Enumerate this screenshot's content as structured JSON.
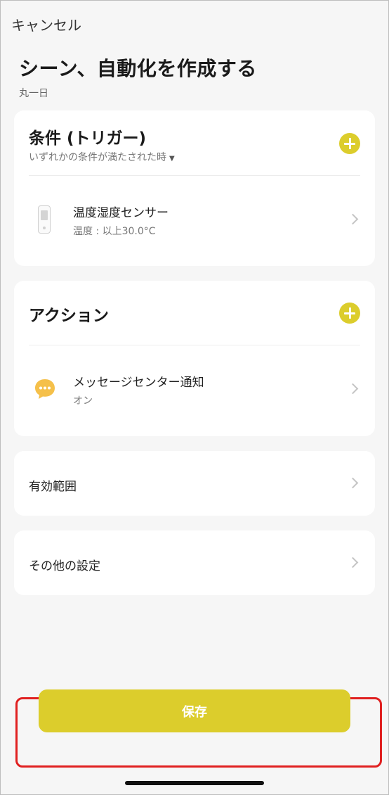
{
  "header": {
    "cancel_label": "キャンセル",
    "title": "シーン、自動化を作成する",
    "subtitle": "丸一日"
  },
  "conditions": {
    "title": "条件 (トリガー)",
    "subtitle": "いずれかの条件が満たされた時",
    "items": [
      {
        "name": "温度湿度センサー",
        "detail": "温度 : 以上30.0°C",
        "icon": "thermo-hygro-sensor-icon"
      }
    ]
  },
  "actions": {
    "title": "アクション",
    "items": [
      {
        "name": "メッセージセンター通知",
        "detail": "オン",
        "icon": "chat-bubble-icon"
      }
    ]
  },
  "settings": {
    "scope_label": "有効範囲",
    "other_label": "その他の設定"
  },
  "footer": {
    "save_label": "保存"
  },
  "colors": {
    "accent": "#dccd2c",
    "highlight_border": "#e02020",
    "background": "#f6f6f6",
    "card": "#ffffff",
    "message_icon": "#f5c04a"
  }
}
